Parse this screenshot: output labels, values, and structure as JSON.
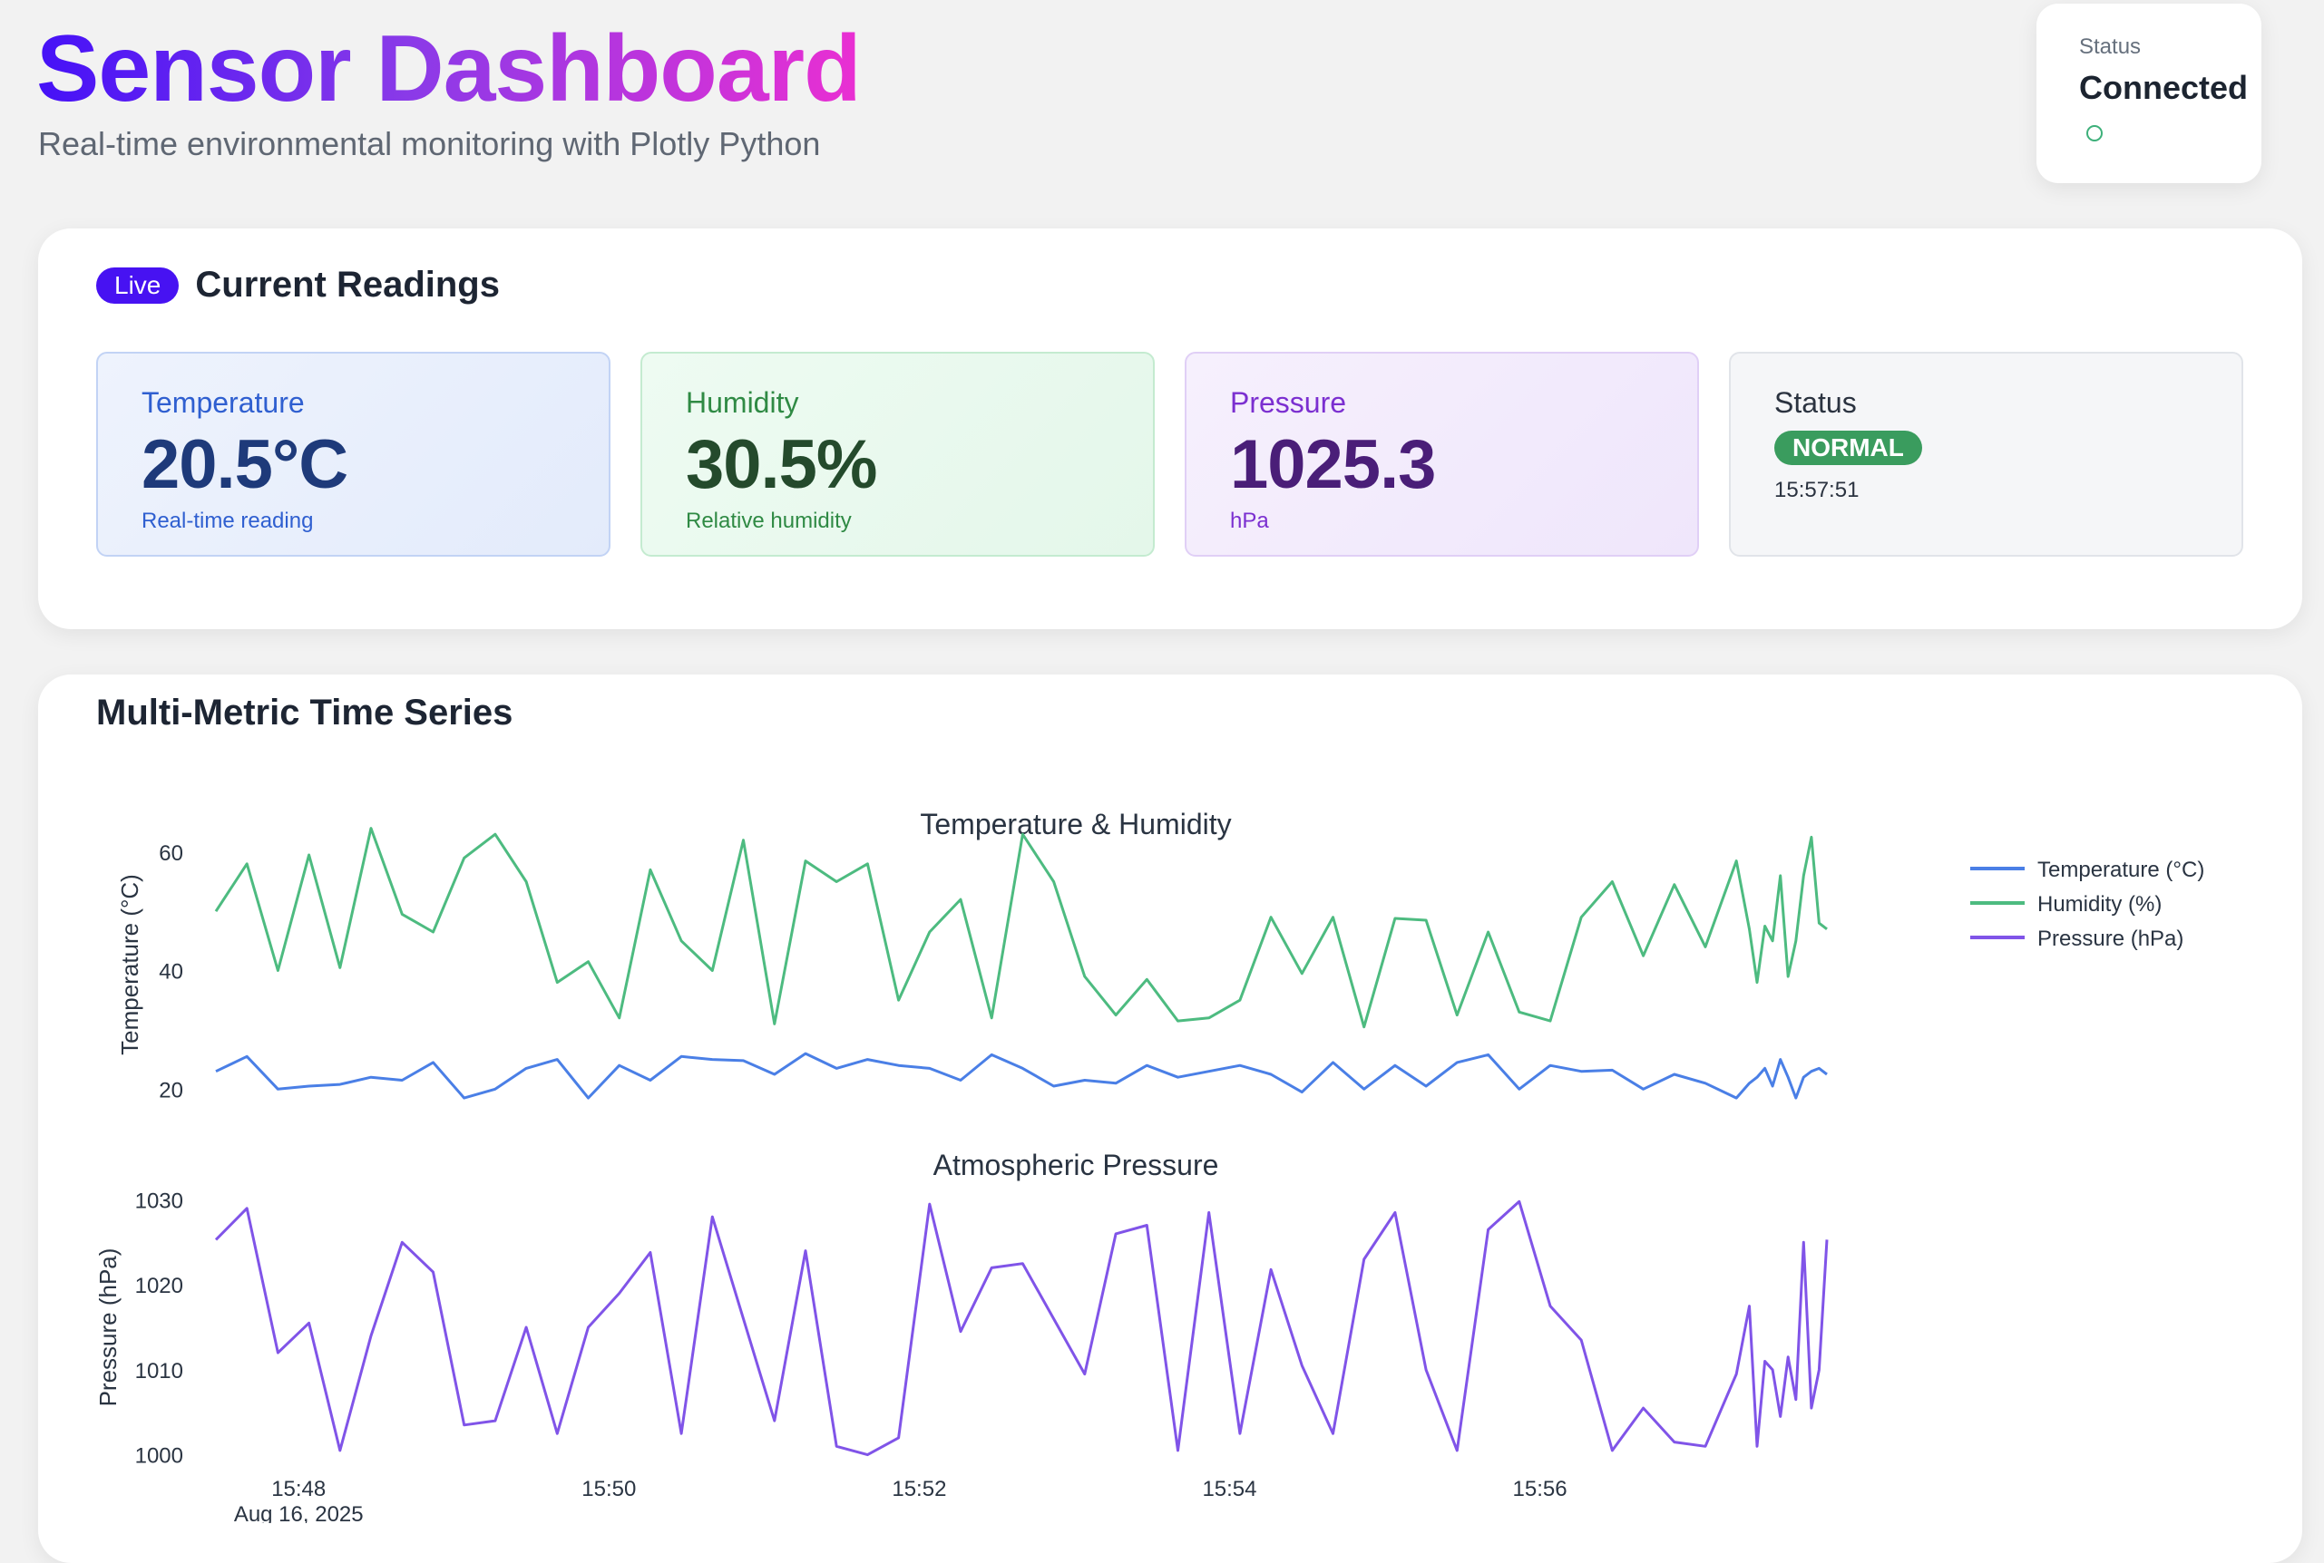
{
  "header": {
    "title": "Sensor Dashboard",
    "subtitle": "Real-time environmental monitoring with Plotly Python"
  },
  "connection": {
    "label": "Status",
    "value": "Connected",
    "indicator_icon": "status-dot-icon",
    "color": "#3db07a"
  },
  "readings": {
    "badge": "Live",
    "title": "Current Readings",
    "cards": [
      {
        "label": "Temperature",
        "value": "20.5°C",
        "sub": "Real-time reading"
      },
      {
        "label": "Humidity",
        "value": "30.5%",
        "sub": "Relative humidity"
      },
      {
        "label": "Pressure",
        "value": "1025.3",
        "sub": "hPa"
      }
    ],
    "status": {
      "label": "Status",
      "badge": "NORMAL",
      "time": "15:57:51"
    }
  },
  "timeseries": {
    "title": "Multi-Metric Time Series"
  },
  "colors": {
    "temperature": "#4a7fe6",
    "humidity": "#4dbb80",
    "pressure": "#8054e8",
    "accent": "#4712f2",
    "normal": "#3a9c5e"
  },
  "chart_data": [
    {
      "type": "line",
      "title": "Temperature & Humidity",
      "ylabel": "Temperature (°C)",
      "ylim": [
        15,
        67
      ],
      "yticks": [
        20,
        40,
        60
      ],
      "x": [
        "15:47:28",
        "15:47:40",
        "15:47:52",
        "15:48:04",
        "15:48:16",
        "15:48:28",
        "15:48:40",
        "15:48:52",
        "15:49:04",
        "15:49:16",
        "15:49:28",
        "15:49:40",
        "15:49:52",
        "15:50:04",
        "15:50:16",
        "15:50:28",
        "15:50:40",
        "15:50:52",
        "15:51:04",
        "15:51:16",
        "15:51:28",
        "15:51:40",
        "15:51:52",
        "15:52:04",
        "15:52:16",
        "15:52:28",
        "15:52:40",
        "15:52:52",
        "15:53:04",
        "15:53:16",
        "15:53:28",
        "15:53:40",
        "15:53:52",
        "15:54:04",
        "15:54:16",
        "15:54:28",
        "15:54:40",
        "15:54:52",
        "15:55:04",
        "15:55:16",
        "15:55:28",
        "15:55:40",
        "15:55:52",
        "15:56:04",
        "15:56:16",
        "15:56:28",
        "15:56:40",
        "15:56:52",
        "15:57:04",
        "15:57:16",
        "15:57:21",
        "15:57:24",
        "15:57:27",
        "15:57:30",
        "15:57:33",
        "15:57:36",
        "15:57:39",
        "15:57:42",
        "15:57:45",
        "15:57:48",
        "15:57:51"
      ],
      "series": [
        {
          "name": "Temperature (°C)",
          "color": "#4a7fe6",
          "values": [
            23,
            25.5,
            20,
            20.5,
            20.8,
            22,
            21.5,
            24.5,
            18.5,
            20,
            23.5,
            25,
            18.5,
            24,
            21.5,
            25.5,
            25,
            24.8,
            22.5,
            26,
            23.5,
            25,
            24,
            23.5,
            21.5,
            25.8,
            23.5,
            20.5,
            21.5,
            21,
            24,
            22,
            23,
            24,
            22.5,
            19.5,
            24.5,
            20,
            24,
            20.5,
            24.5,
            25.8,
            20,
            24,
            23,
            23.2,
            20,
            22.5,
            21,
            18.5,
            21,
            22,
            23.5,
            20.5,
            25,
            22,
            18.5,
            22,
            23,
            23.5,
            22.5
          ]
        },
        {
          "name": "Humidity (%)",
          "color": "#4dbb80",
          "values": [
            50,
            58,
            40,
            59.5,
            40.5,
            64,
            49.5,
            46.5,
            59,
            63,
            55,
            38,
            41.5,
            32,
            57,
            45,
            40,
            62,
            31,
            58.5,
            55,
            58,
            35,
            46.5,
            52,
            32,
            63,
            55,
            39,
            32.5,
            38.5,
            31.5,
            32,
            35,
            49,
            39.5,
            49,
            30.5,
            48.8,
            48.5,
            32.5,
            46.5,
            33,
            31.5,
            49,
            55,
            42.5,
            54.5,
            44,
            58.5,
            47,
            38,
            47.5,
            45,
            56,
            39,
            45,
            56,
            62.5,
            48,
            47
          ]
        },
        {
          "name": "Pressure (hPa)",
          "color": "#8054e8",
          "values": []
        }
      ]
    },
    {
      "type": "line",
      "title": "Atmospheric Pressure",
      "ylabel": "Pressure (hPa)",
      "ylim": [
        999,
        1031
      ],
      "yticks": [
        1000,
        1010,
        1020,
        1030
      ],
      "xticks": [
        "15:48",
        "15:50",
        "15:52",
        "15:54",
        "15:56"
      ],
      "xdate": "Aug 16, 2025",
      "x": [
        "15:47:28",
        "15:47:40",
        "15:47:52",
        "15:48:04",
        "15:48:16",
        "15:48:28",
        "15:48:40",
        "15:48:52",
        "15:49:04",
        "15:49:16",
        "15:49:28",
        "15:49:40",
        "15:49:52",
        "15:50:04",
        "15:50:16",
        "15:50:28",
        "15:50:40",
        "15:50:52",
        "15:51:04",
        "15:51:16",
        "15:51:28",
        "15:51:40",
        "15:51:52",
        "15:52:04",
        "15:52:16",
        "15:52:28",
        "15:52:40",
        "15:52:52",
        "15:53:04",
        "15:53:16",
        "15:53:28",
        "15:53:40",
        "15:53:52",
        "15:54:04",
        "15:54:16",
        "15:54:28",
        "15:54:40",
        "15:54:52",
        "15:55:04",
        "15:55:16",
        "15:55:28",
        "15:55:40",
        "15:55:52",
        "15:56:04",
        "15:56:16",
        "15:56:28",
        "15:56:40",
        "15:56:52",
        "15:57:04",
        "15:57:16",
        "15:57:21",
        "15:57:24",
        "15:57:27",
        "15:57:30",
        "15:57:33",
        "15:57:36",
        "15:57:39",
        "15:57:42",
        "15:57:45",
        "15:57:48",
        "15:57:51"
      ],
      "series": [
        {
          "name": "Pressure (hPa)",
          "color": "#8054e8",
          "values": [
            1025.3,
            1029,
            1012,
            1015.5,
            1000.5,
            1014,
            1025,
            1021.5,
            1003.5,
            1004,
            1015,
            1002.5,
            1015,
            1019,
            1023.8,
            1002.5,
            1028,
            1016,
            1004,
            1024,
            1001,
            1000,
            1002,
            1029.5,
            1014.5,
            1022,
            1022.5,
            1016,
            1009.5,
            1026,
            1027,
            1000.5,
            1028.5,
            1002.5,
            1021.8,
            1010.5,
            1002.5,
            1023,
            1028.5,
            1010,
            1000.5,
            1026.5,
            1029.8,
            1017.5,
            1013.5,
            1000.5,
            1005.5,
            1001.5,
            1001,
            1009.5,
            1017.5,
            1001,
            1011,
            1010,
            1004.5,
            1011.5,
            1006.5,
            1025,
            1005.5,
            1010,
            1025.3
          ]
        }
      ]
    }
  ]
}
